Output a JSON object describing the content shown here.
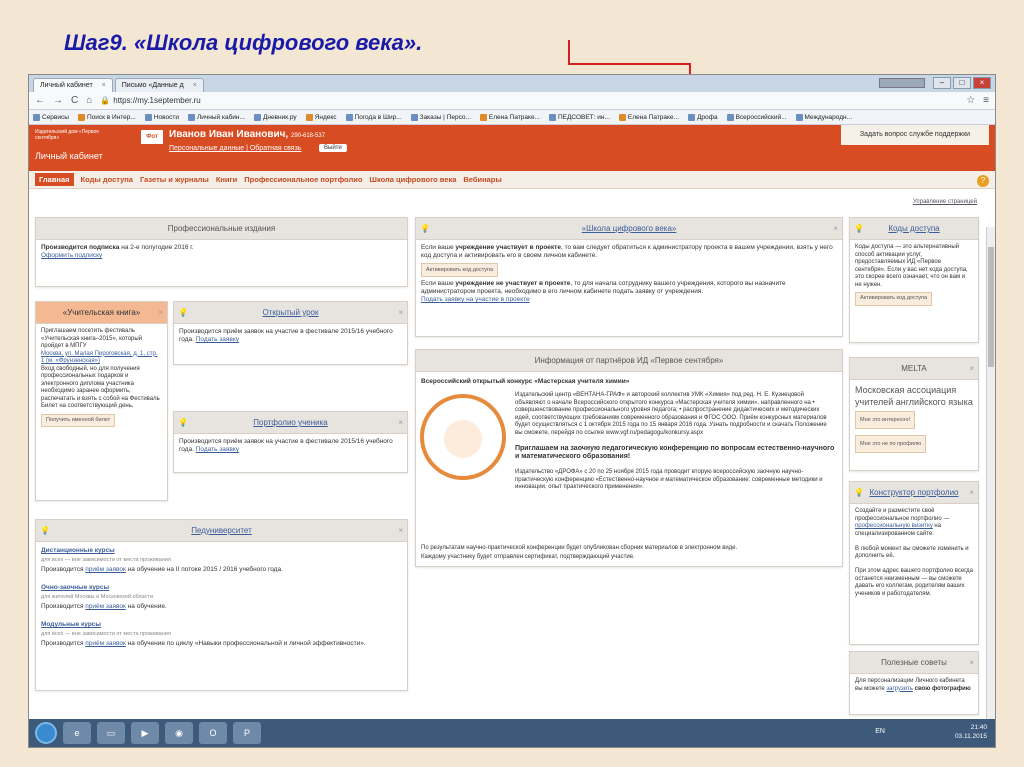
{
  "slide": {
    "title": "Шаг9.  «Школа цифрового века»."
  },
  "browser": {
    "tabs": [
      {
        "label": "Личный кабинет",
        "close": "×"
      },
      {
        "label": "Письмо «Данные д",
        "close": "×"
      }
    ],
    "url": "https://my.1september.ru",
    "bookmarks": [
      "Сервисы",
      "Поиск в Интер...",
      "Новости",
      "Личный кабин...",
      "Дневник.ру",
      "Яндекс",
      "Погода в Шир...",
      "Заказы | Персо...",
      "Елена Патраке...",
      "ПЕДСОВЕТ: ин...",
      "Елена Патраке...",
      "Дрофа",
      "Всероссийский...",
      "Международн..."
    ]
  },
  "site": {
    "logo_small": "Издательский дом «Первое сентября»",
    "logo_big": "Личный кабинет",
    "user_photo": "Фот",
    "user_name": "Иванов Иван Иванович,",
    "user_phone": "290-618-537",
    "user_links": "Персональные данные | Обратная связь",
    "logout": "Выйти",
    "support": "Задать вопрос службе поддержки",
    "nav": [
      "Главная",
      "Коды доступа",
      "Газеты и журналы",
      "Книги",
      "Профессиональное портфолио",
      "Школа цифрового века",
      "Вебинары"
    ],
    "manage": "Управление страницей"
  },
  "panels": {
    "prof": {
      "title": "Профессиональные издания",
      "text1": "Производится подписка",
      "text2": " на 2-е полугодие 2016 г.",
      "link": "Оформить подписку"
    },
    "book": {
      "title": "«Учительская книга»",
      "text": "Приглашаем посетить фестиваль «Учительская книга–2015», который пройдет в МПГУ",
      "addr": "Москва, ул. Малая Пироговская, д. 1, стр. 1 (м. «Фрунзенская»)",
      "text2": "Вход свободный, но для получения профессиональных подарков и электронного диплома участника необходимо заранее оформить, распечатать и взять с собой на Фестиваль Билет на соответствующий день.",
      "btn": "Получить именной билет"
    },
    "lesson": {
      "title": "Открытый урок",
      "text": "Производится приём заявок на участие в фестивале 2015/16 учебного года.",
      "link": "Подать заявку"
    },
    "portfolio": {
      "title": "Портфолио ученика",
      "text": "Производится приём заявок на участие в фестивале 2015/16 учебного года.",
      "link": "Подать заявку"
    },
    "univ": {
      "title": "Педуниверситет",
      "sections": [
        {
          "head": "Дистанционные курсы",
          "note": "для всех — вне зависимости от места проживания",
          "text": "Производится",
          "link": "приём заявок",
          "tail": " на обучение на II потоке 2015 / 2016 учебного года."
        },
        {
          "head": "Очно-заочные курсы",
          "note": "для жителей Москвы и Московской области",
          "text": "Производится",
          "link": "приём заявок",
          "tail": " на обучение."
        },
        {
          "head": "Модульные курсы",
          "note": "для всех — вне зависимости от места проживания",
          "text": "Производится",
          "link": "приём заявок",
          "tail": " на обучение по циклу «Навыки профессиональной и личной эффективности»."
        }
      ]
    },
    "school": {
      "title": "«Школа цифрового века»",
      "p1a": "Если ваше ",
      "p1b": "учреждение участвует в проекте",
      "p1c": ", то вам следует обратиться к администратору проекта в вашем учреждении, взять у него код доступа и активировать его в своем личном кабинете.",
      "btn": "Активировать код доступа",
      "p2a": "Если ваше ",
      "p2b": "учреждение не участвует в проекте",
      "p2c": ", то для начала сотруднику вашего учреждения, которого вы назначите администратором проекта, необходимо в его личном кабинете подать заявку от учреждения.",
      "link": "Подать заявку на участие в проекте"
    },
    "partners": {
      "title": "Информация от партнёров ИД «Первое сентября»",
      "contest_head": "Всероссийский открытый конкурс «Мастерская учителя химии»",
      "contest_text": "Издательский центр «ВЕНТАНА-ГРАФ» и авторский коллектив УМК «Химия» под ред. Н. Е. Кузнецовой объявляют о начале Всероссийского открытого конкурса «Мастерская учителя химии», направленного на • совершенствование профессионального уровня педагога; • распространение дидактических и методических идей, соответствующих требованиям современного образования и ФГОС ООО. Приём конкурсных материалов будет осуществляться с 1 октября 2015 года по 15 января 2016 года. Узнать подробности и скачать Положение вы сможете, перейдя по ссылке www.vgf.ru/pedagogu/konkursy.aspx",
      "conf_head": "Приглашаем на заочную педагогическую конференцию по вопросам естественно-научного и математического образования!",
      "conf_text": "Издательство «ДРОФА» с 20 по 25 ноября 2015 года проводит вторую всероссийскую заочную научно-практическую конференцию «Естественно-научное и математическое образование: современные методики и инновации, опыт практического применения».",
      "conf_text2": "По результатам научно-практической конференции будет опубликован сборник материалов в электронном виде.",
      "conf_text3": "Каждому участнику будет отправлен сертификат, подтверждающий участие.",
      "logo_text": "КОНКУРС «МАСТЕРСКАЯ УЧИТЕЛЯ ХИМИИ»"
    },
    "codes": {
      "title": "Коды доступа",
      "text": "Коды доступа — это альтернативный способ активации услуг, предоставляемых ИД «Первое сентября». Если у вас нет кода доступа, это скорее всего означает, что он вам и не нужен.",
      "btn": "Активировать код доступа"
    },
    "melta": {
      "title": "MELTA",
      "text": "Московская ассоциация учителей английского языка",
      "btn1": "Мне это интересно!",
      "btn2": "Мне это не по профилю"
    },
    "constructor": {
      "title": "Конструктор портфолио",
      "text1": "Создайте и разместите своё профессиональное портфолио —",
      "link": "профессиональную визитку",
      "text2": "на специализированном сайте.",
      "text3": "В любой момент вы сможете изменить и дополнить её.",
      "text4": "При этом адрес вашего портфолио всегда останется неизменным — вы сможете давать его коллегам, родителям ваших учеников и работодателям."
    },
    "tips": {
      "title": "Полезные советы",
      "text": "Для персонализации Личного кабинета вы можете",
      "link": "загрузить",
      "tail": "свою фотографию"
    }
  },
  "taskbar": {
    "lang": "EN",
    "time": "21:40",
    "date": "03.11.2015"
  }
}
